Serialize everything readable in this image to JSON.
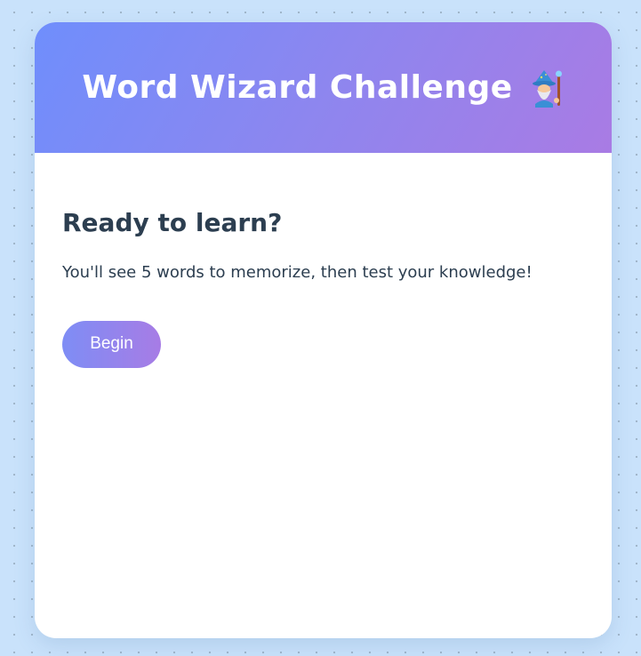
{
  "header": {
    "title": "Word Wizard Challenge",
    "icon": "wizard-icon"
  },
  "intro": {
    "heading": "Ready to learn?",
    "description": "You'll see 5 words to memorize, then test your knowledge!",
    "begin_label": "Begin"
  },
  "colors": {
    "page_background": "#c9e2fb",
    "header_gradient_start": "#6f8efc",
    "header_gradient_end": "#a97be4",
    "text": "#2c3e50",
    "button_gradient_start": "#7e8df5",
    "button_gradient_end": "#a77ce5"
  }
}
